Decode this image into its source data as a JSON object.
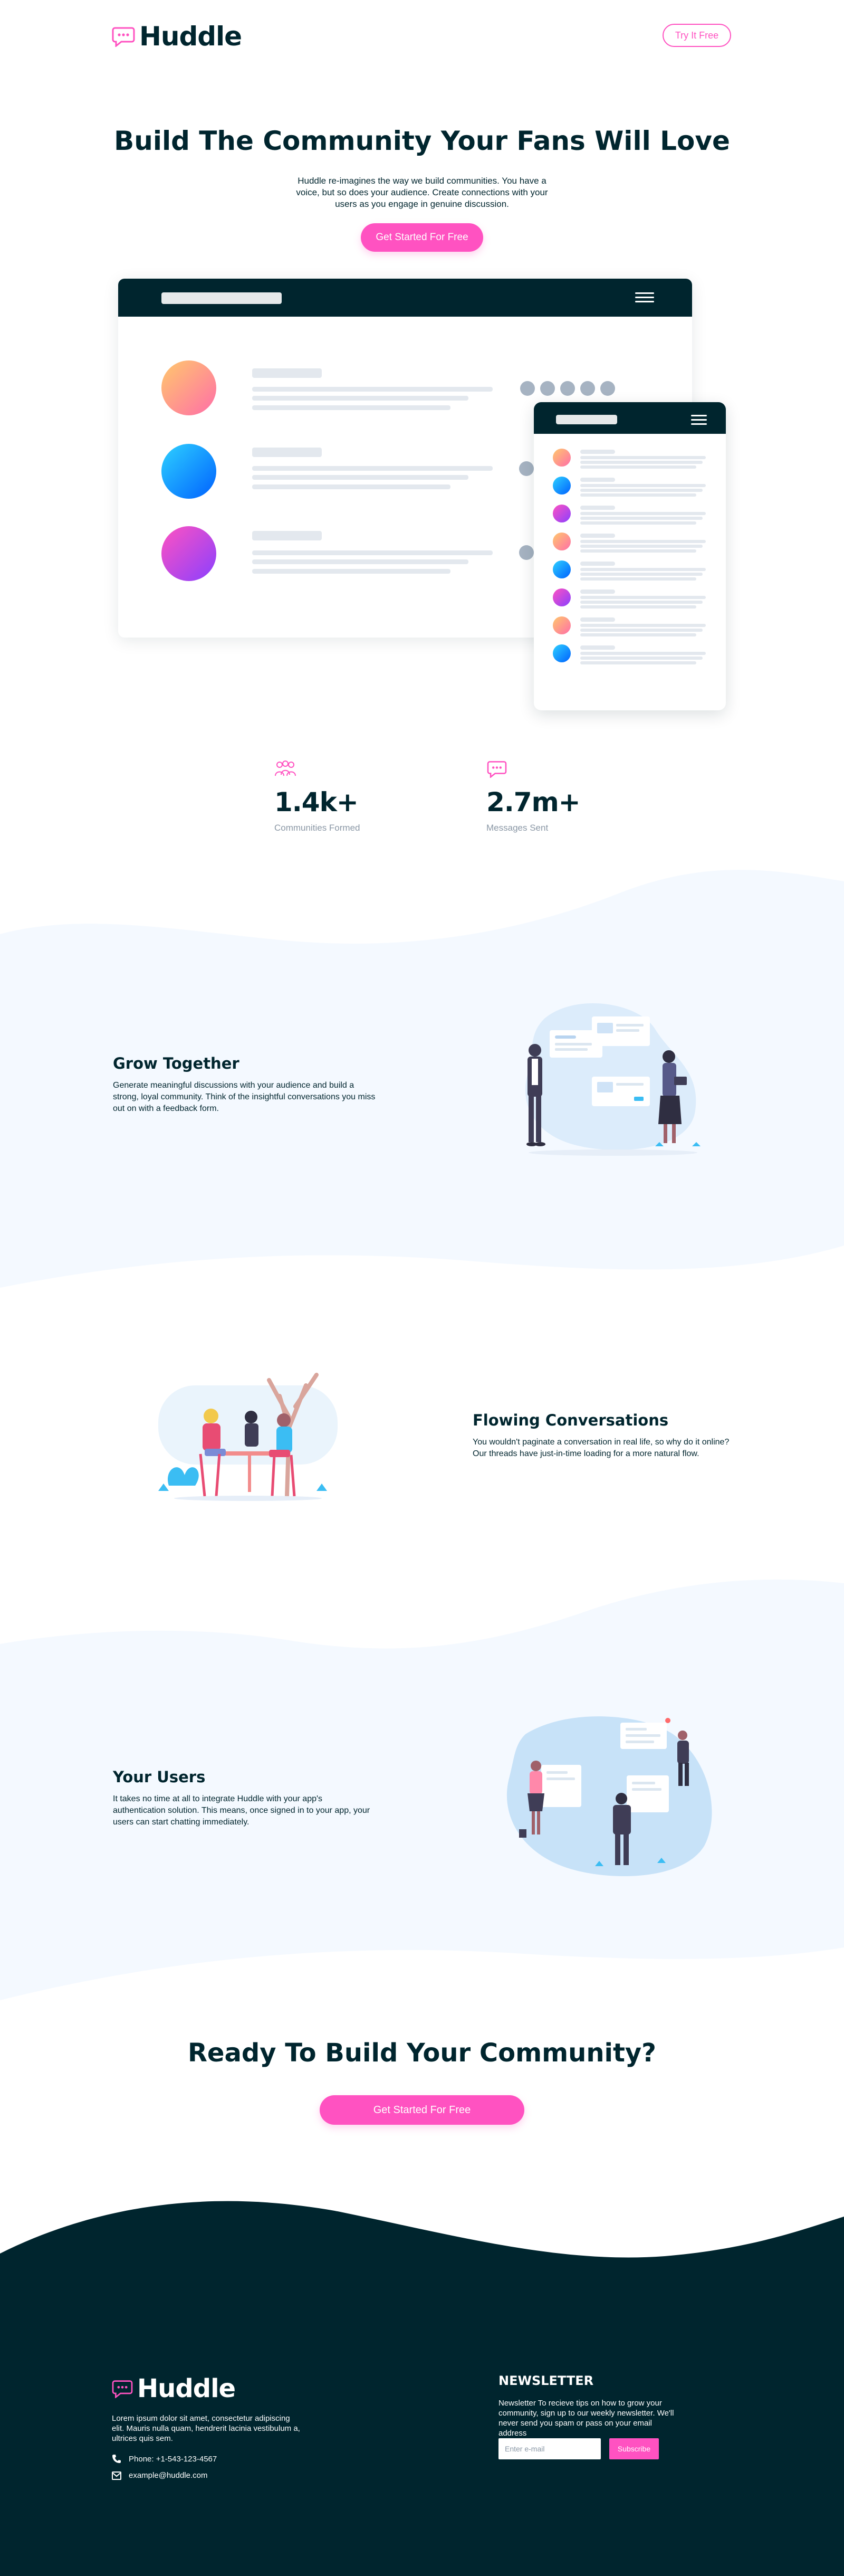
{
  "header": {
    "brand": "Huddle",
    "cta_label": "Try It Free"
  },
  "hero": {
    "title": "Build The Community Your Fans Will Love",
    "subtitle": "Huddle re-imagines the way we build communities. You have a voice, but so does your audience. Create connections with your users as you engage in genuine discussion.",
    "cta_label": "Get Started For Free"
  },
  "stats": [
    {
      "icon": "communities-icon",
      "value": "1.4k+",
      "label": "Communities Formed"
    },
    {
      "icon": "messages-icon",
      "value": "2.7m+",
      "label": "Messages Sent"
    }
  ],
  "features": [
    {
      "title": "Grow Together",
      "text": "Generate meaningful discussions with your audience and build a strong, loyal community. Think of the insightful conversations you miss out on with a feedback form.",
      "illustration": "grow-together-illustration"
    },
    {
      "title": "Flowing Conversations",
      "text": "You wouldn't paginate a conversation in real life, so why do it online? Our threads have just-in-time loading for a more natural flow.",
      "illustration": "flowing-conversations-illustration"
    },
    {
      "title": "Your Users",
      "text": "It takes no time at all to integrate Huddle with your app's authentication solution. This means, once signed in to your app, your users can start chatting immediately.",
      "illustration": "your-users-illustration"
    }
  ],
  "cta": {
    "title": "Ready To Build Your Community?",
    "button_label": "Get Started For Free"
  },
  "footer": {
    "brand": "Huddle",
    "description": "Lorem ipsum dolor sit amet, consectetur adipiscing elit. Mauris nulla quam, hendrerit lacinia vestibulum a, ultrices quis sem.",
    "phone": "Phone: +1-543-123-4567",
    "email": "example@huddle.com",
    "newsletter_title": "NEWSLETTER",
    "newsletter_text": "Newsletter To recieve tips on how to grow your community, sign up to our weekly newsletter. We'll never send you spam or pass on your email address",
    "email_placeholder": "Enter e-mail",
    "subscribe_label": "Subscribe"
  },
  "colors": {
    "brand_dark": "#00252e",
    "accent_pink": "#ff52c1",
    "section_bg": "#f4f9ff"
  }
}
